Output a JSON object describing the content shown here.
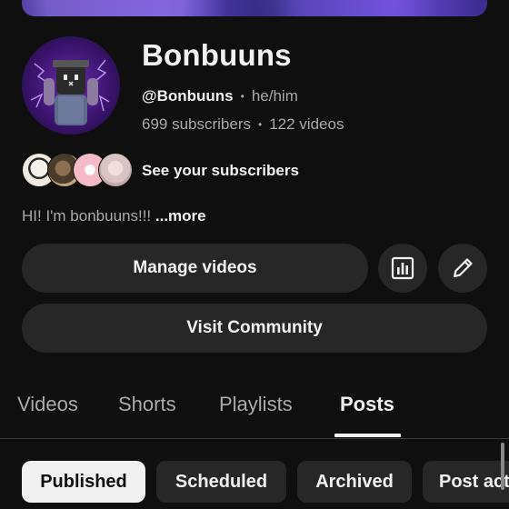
{
  "channel": {
    "name": "Bonbuuns",
    "handle": "@Bonbuuns",
    "separator": "•",
    "pronouns": "he/him",
    "subscribers": "699 subscribers",
    "videos": "122 videos",
    "see_subscribers": "See your subscribers",
    "bio": "HI! I'm bonbuuns!!! ",
    "bio_more": "...more"
  },
  "actions": {
    "manage_videos": "Manage videos",
    "visit_community": "Visit Community",
    "analytics_icon": "analytics-icon",
    "edit_icon": "pencil-icon"
  },
  "tabs": [
    {
      "label": "Videos",
      "active": false
    },
    {
      "label": "Shorts",
      "active": false
    },
    {
      "label": "Playlists",
      "active": false
    },
    {
      "label": "Posts",
      "active": true
    }
  ],
  "chips": [
    {
      "label": "Published",
      "selected": true
    },
    {
      "label": "Scheduled",
      "selected": false
    },
    {
      "label": "Archived",
      "selected": false
    },
    {
      "label": "Post acti",
      "selected": false
    }
  ],
  "colors": {
    "background": "#0f0f0f",
    "surface": "#272727",
    "text_primary": "#f1f1f1",
    "text_secondary": "#aaaaaa",
    "banner_accent": "#5b3fc4"
  }
}
